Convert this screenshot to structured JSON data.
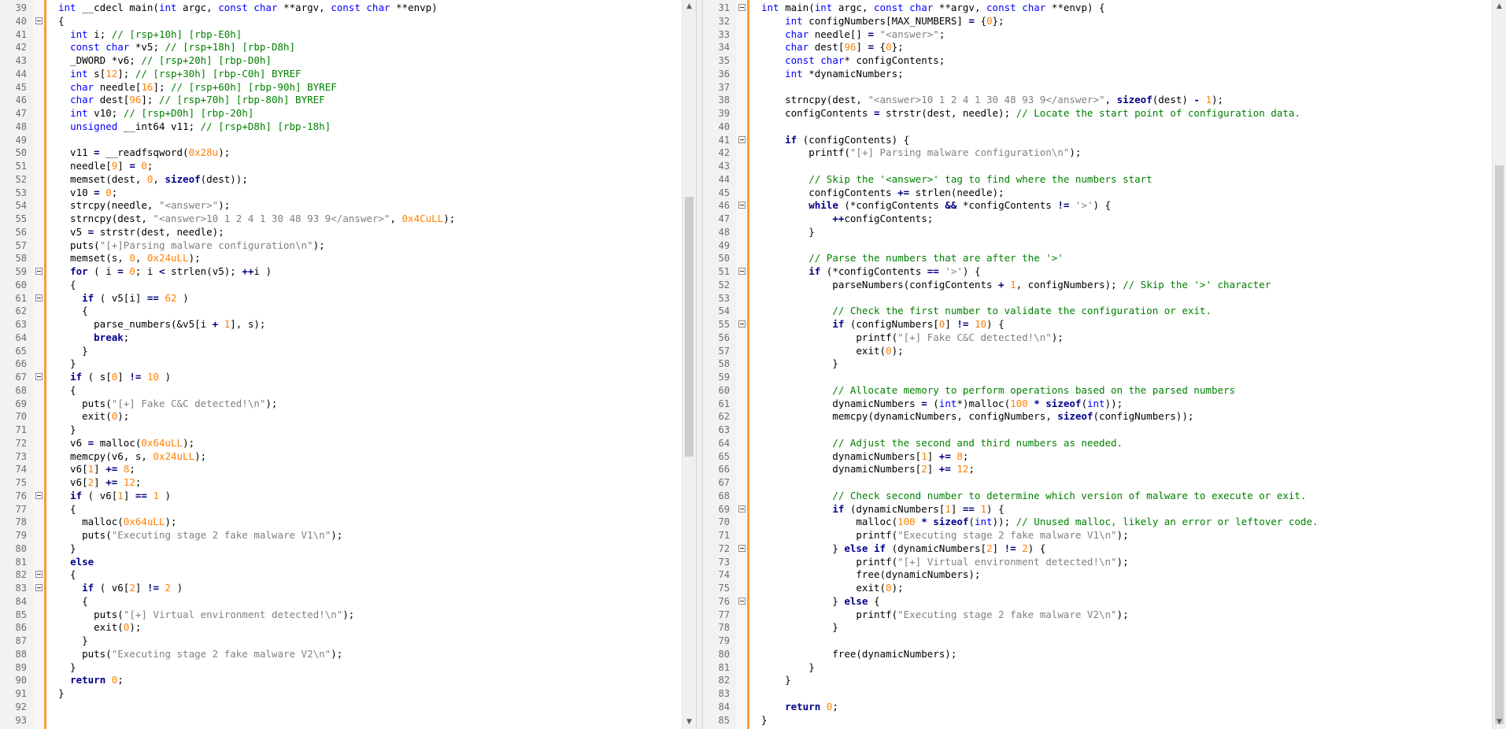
{
  "left_pane": {
    "lines": [
      {
        "n": "39",
        "fold": false,
        "html": "<span class=\"kw\">int</span> __cdecl main(<span class=\"kw\">int</span> argc, <span class=\"kw\">const</span> <span class=\"kw\">char</span> **argv, <span class=\"kw\">const</span> <span class=\"kw\">char</span> **envp)"
      },
      {
        "n": "40",
        "fold": true,
        "html": "{"
      },
      {
        "n": "41",
        "fold": false,
        "html": "  <span class=\"kw\">int</span> i; <span class=\"cm\">// [rsp+10h] [rbp-E0h]</span>"
      },
      {
        "n": "42",
        "fold": false,
        "html": "  <span class=\"kw\">const</span> <span class=\"kw\">char</span> *v5; <span class=\"cm\">// [rsp+18h] [rbp-D8h]</span>"
      },
      {
        "n": "43",
        "fold": false,
        "html": "  _DWORD *v6; <span class=\"cm\">// [rsp+20h] [rbp-D0h]</span>"
      },
      {
        "n": "44",
        "fold": false,
        "html": "  <span class=\"kw\">int</span> s[<span class=\"num\">12</span>]; <span class=\"cm\">// [rsp+30h] [rbp-C0h] BYREF</span>"
      },
      {
        "n": "45",
        "fold": false,
        "html": "  <span class=\"kw\">char</span> needle[<span class=\"num\">16</span>]; <span class=\"cm\">// [rsp+60h] [rbp-90h] BYREF</span>"
      },
      {
        "n": "46",
        "fold": false,
        "html": "  <span class=\"kw\">char</span> dest[<span class=\"num\">96</span>]; <span class=\"cm\">// [rsp+70h] [rbp-80h] BYREF</span>"
      },
      {
        "n": "47",
        "fold": false,
        "html": "  <span class=\"kw\">int</span> v10; <span class=\"cm\">// [rsp+D0h] [rbp-20h]</span>"
      },
      {
        "n": "48",
        "fold": false,
        "html": "  <span class=\"kw\">unsigned</span> __int64 v11; <span class=\"cm\">// [rsp+D8h] [rbp-18h]</span>"
      },
      {
        "n": "49",
        "fold": false,
        "html": ""
      },
      {
        "n": "50",
        "fold": false,
        "html": "  v11 <span class=\"op\">=</span> __readfsqword(<span class=\"num\">0x28u</span>);"
      },
      {
        "n": "51",
        "fold": false,
        "html": "  needle[<span class=\"num\">9</span>] <span class=\"op\">=</span> <span class=\"num\">0</span>;"
      },
      {
        "n": "52",
        "fold": false,
        "html": "  memset(dest, <span class=\"num\">0</span>, <span class=\"kwb\">sizeof</span>(dest));"
      },
      {
        "n": "53",
        "fold": false,
        "html": "  v10 <span class=\"op\">=</span> <span class=\"num\">0</span>;"
      },
      {
        "n": "54",
        "fold": false,
        "html": "  strcpy(needle, <span class=\"str\">\"&lt;answer&gt;\"</span>);"
      },
      {
        "n": "55",
        "fold": false,
        "html": "  strncpy(dest, <span class=\"str\">\"&lt;answer&gt;10 1 2 4 1 30 48 93 9&lt;/answer&gt;\"</span>, <span class=\"num\">0x4CuLL</span>);"
      },
      {
        "n": "56",
        "fold": false,
        "html": "  v5 <span class=\"op\">=</span> strstr(dest, needle);"
      },
      {
        "n": "57",
        "fold": false,
        "html": "  puts(<span class=\"str\">\"[+]Parsing malware configuration\\n\"</span>);"
      },
      {
        "n": "58",
        "fold": false,
        "html": "  memset(s, <span class=\"num\">0</span>, <span class=\"num\">0x24uLL</span>);"
      },
      {
        "n": "59",
        "fold": true,
        "html": "  <span class=\"kwb\">for</span> ( i <span class=\"op\">=</span> <span class=\"num\">0</span>; i <span class=\"op\">&lt;</span> strlen(v5); <span class=\"op\">++</span>i )"
      },
      {
        "n": "60",
        "fold": false,
        "html": "  {"
      },
      {
        "n": "61",
        "fold": true,
        "html": "    <span class=\"kwb\">if</span> ( v5[i] <span class=\"op\">==</span> <span class=\"num\">62</span> )"
      },
      {
        "n": "62",
        "fold": false,
        "html": "    {"
      },
      {
        "n": "63",
        "fold": false,
        "html": "      parse_numbers(&amp;v5[i <span class=\"op\">+</span> <span class=\"num\">1</span>], s);"
      },
      {
        "n": "64",
        "fold": false,
        "html": "      <span class=\"kwb\">break</span>;"
      },
      {
        "n": "65",
        "fold": false,
        "html": "    }"
      },
      {
        "n": "66",
        "fold": false,
        "html": "  }"
      },
      {
        "n": "67",
        "fold": true,
        "html": "  <span class=\"kwb\">if</span> ( s[<span class=\"num\">0</span>] <span class=\"op\">!=</span> <span class=\"num\">10</span> )"
      },
      {
        "n": "68",
        "fold": false,
        "html": "  {"
      },
      {
        "n": "69",
        "fold": false,
        "html": "    puts(<span class=\"str\">\"[+] Fake C&amp;C detected!\\n\"</span>);"
      },
      {
        "n": "70",
        "fold": false,
        "html": "    exit(<span class=\"num\">0</span>);"
      },
      {
        "n": "71",
        "fold": false,
        "html": "  }"
      },
      {
        "n": "72",
        "fold": false,
        "html": "  v6 <span class=\"op\">=</span> malloc(<span class=\"num\">0x64uLL</span>);"
      },
      {
        "n": "73",
        "fold": false,
        "html": "  memcpy(v6, s, <span class=\"num\">0x24uLL</span>);"
      },
      {
        "n": "74",
        "fold": false,
        "html": "  v6[<span class=\"num\">1</span>] <span class=\"op\">+=</span> <span class=\"num\">8</span>;"
      },
      {
        "n": "75",
        "fold": false,
        "html": "  v6[<span class=\"num\">2</span>] <span class=\"op\">+=</span> <span class=\"num\">12</span>;"
      },
      {
        "n": "76",
        "fold": true,
        "html": "  <span class=\"kwb\">if</span> ( v6[<span class=\"num\">1</span>] <span class=\"op\">==</span> <span class=\"num\">1</span> )"
      },
      {
        "n": "77",
        "fold": false,
        "html": "  {"
      },
      {
        "n": "78",
        "fold": false,
        "html": "    malloc(<span class=\"num\">0x64uLL</span>);"
      },
      {
        "n": "79",
        "fold": false,
        "html": "    puts(<span class=\"str\">\"Executing stage 2 fake malware V1\\n\"</span>);"
      },
      {
        "n": "80",
        "fold": false,
        "html": "  }"
      },
      {
        "n": "81",
        "fold": false,
        "html": "  <span class=\"kwb\">else</span>"
      },
      {
        "n": "82",
        "fold": true,
        "html": "  {"
      },
      {
        "n": "83",
        "fold": true,
        "html": "    <span class=\"kwb\">if</span> ( v6[<span class=\"num\">2</span>] <span class=\"op\">!=</span> <span class=\"num\">2</span> )"
      },
      {
        "n": "84",
        "fold": false,
        "html": "    {"
      },
      {
        "n": "85",
        "fold": false,
        "html": "      puts(<span class=\"str\">\"[+] Virtual environment detected!\\n\"</span>);"
      },
      {
        "n": "86",
        "fold": false,
        "html": "      exit(<span class=\"num\">0</span>);"
      },
      {
        "n": "87",
        "fold": false,
        "html": "    }"
      },
      {
        "n": "88",
        "fold": false,
        "html": "    puts(<span class=\"str\">\"Executing stage 2 fake malware V2\\n\"</span>);"
      },
      {
        "n": "89",
        "fold": false,
        "html": "  }"
      },
      {
        "n": "90",
        "fold": false,
        "html": "  <span class=\"kwb\">return</span> <span class=\"num\">0</span>;"
      },
      {
        "n": "91",
        "fold": false,
        "html": "}"
      },
      {
        "n": "92",
        "fold": false,
        "html": ""
      },
      {
        "n": "93",
        "fold": false,
        "html": ""
      }
    ]
  },
  "right_pane": {
    "lines": [
      {
        "n": "31",
        "fold": true,
        "html": "<span class=\"kw\">int</span> main(<span class=\"kw\">int</span> argc, <span class=\"kw\">const</span> <span class=\"kw\">char</span> **argv, <span class=\"kw\">const</span> <span class=\"kw\">char</span> **envp) {"
      },
      {
        "n": "32",
        "fold": false,
        "html": "    <span class=\"kw\">int</span> configNumbers[MAX_NUMBERS] <span class=\"op\">=</span> {<span class=\"num\">0</span>};"
      },
      {
        "n": "33",
        "fold": false,
        "html": "    <span class=\"kw\">char</span> needle[] <span class=\"op\">=</span> <span class=\"str\">\"&lt;answer&gt;\"</span>;"
      },
      {
        "n": "34",
        "fold": false,
        "html": "    <span class=\"kw\">char</span> dest[<span class=\"num\">96</span>] <span class=\"op\">=</span> {<span class=\"num\">0</span>};"
      },
      {
        "n": "35",
        "fold": false,
        "html": "    <span class=\"kw\">const</span> <span class=\"kw\">char</span>* configContents;"
      },
      {
        "n": "36",
        "fold": false,
        "html": "    <span class=\"kw\">int</span> *dynamicNumbers;"
      },
      {
        "n": "37",
        "fold": false,
        "html": "    "
      },
      {
        "n": "38",
        "fold": false,
        "html": "    strncpy(dest, <span class=\"str\">\"&lt;answer&gt;10 1 2 4 1 30 48 93 9&lt;/answer&gt;\"</span>, <span class=\"kwb\">sizeof</span>(dest) <span class=\"op\">-</span> <span class=\"num\">1</span>);"
      },
      {
        "n": "39",
        "fold": false,
        "html": "    configContents <span class=\"op\">=</span> strstr(dest, needle); <span class=\"cm\">// Locate the start point of configuration data.</span>"
      },
      {
        "n": "40",
        "fold": false,
        "html": "    "
      },
      {
        "n": "41",
        "fold": true,
        "html": "    <span class=\"kwb\">if</span> (configContents) {"
      },
      {
        "n": "42",
        "fold": false,
        "html": "        printf(<span class=\"str\">\"[+] Parsing malware configuration\\n\"</span>);"
      },
      {
        "n": "43",
        "fold": false,
        "html": "        "
      },
      {
        "n": "44",
        "fold": false,
        "html": "        <span class=\"cm\">// Skip the '&lt;answer&gt;' tag to find where the numbers start</span>"
      },
      {
        "n": "45",
        "fold": false,
        "html": "        configContents <span class=\"op\">+=</span> strlen(needle);"
      },
      {
        "n": "46",
        "fold": true,
        "html": "        <span class=\"kwb\">while</span> (*configContents <span class=\"op\">&amp;&amp;</span> *configContents <span class=\"op\">!=</span> <span class=\"str\">'&gt;'</span>) {"
      },
      {
        "n": "47",
        "fold": false,
        "html": "            <span class=\"op\">++</span>configContents;"
      },
      {
        "n": "48",
        "fold": false,
        "html": "        }"
      },
      {
        "n": "49",
        "fold": false,
        "html": "        "
      },
      {
        "n": "50",
        "fold": false,
        "html": "        <span class=\"cm\">// Parse the numbers that are after the '&gt;'</span>"
      },
      {
        "n": "51",
        "fold": true,
        "html": "        <span class=\"kwb\">if</span> (*configContents <span class=\"op\">==</span> <span class=\"str\">'&gt;'</span>) {"
      },
      {
        "n": "52",
        "fold": false,
        "html": "            parseNumbers(configContents <span class=\"op\">+</span> <span class=\"num\">1</span>, configNumbers); <span class=\"cm\">// Skip the '&gt;' character</span>"
      },
      {
        "n": "53",
        "fold": false,
        "html": "            "
      },
      {
        "n": "54",
        "fold": false,
        "html": "            <span class=\"cm\">// Check the first number to validate the configuration or exit.</span>"
      },
      {
        "n": "55",
        "fold": true,
        "html": "            <span class=\"kwb\">if</span> (configNumbers[<span class=\"num\">0</span>] <span class=\"op\">!=</span> <span class=\"num\">10</span>) {"
      },
      {
        "n": "56",
        "fold": false,
        "html": "                printf(<span class=\"str\">\"[+] Fake C&amp;C detected!\\n\"</span>);"
      },
      {
        "n": "57",
        "fold": false,
        "html": "                exit(<span class=\"num\">0</span>);"
      },
      {
        "n": "58",
        "fold": false,
        "html": "            }"
      },
      {
        "n": "59",
        "fold": false,
        "html": "            "
      },
      {
        "n": "60",
        "fold": false,
        "html": "            <span class=\"cm\">// Allocate memory to perform operations based on the parsed numbers</span>"
      },
      {
        "n": "61",
        "fold": false,
        "html": "            dynamicNumbers <span class=\"op\">=</span> (<span class=\"kw\">int</span>*)malloc(<span class=\"num\">100</span> <span class=\"op\">*</span> <span class=\"kwb\">sizeof</span>(<span class=\"kw\">int</span>));"
      },
      {
        "n": "62",
        "fold": false,
        "html": "            memcpy(dynamicNumbers, configNumbers, <span class=\"kwb\">sizeof</span>(configNumbers));"
      },
      {
        "n": "63",
        "fold": false,
        "html": "            "
      },
      {
        "n": "64",
        "fold": false,
        "html": "            <span class=\"cm\">// Adjust the second and third numbers as needed.</span>"
      },
      {
        "n": "65",
        "fold": false,
        "html": "            dynamicNumbers[<span class=\"num\">1</span>] <span class=\"op\">+=</span> <span class=\"num\">8</span>;"
      },
      {
        "n": "66",
        "fold": false,
        "html": "            dynamicNumbers[<span class=\"num\">2</span>] <span class=\"op\">+=</span> <span class=\"num\">12</span>;"
      },
      {
        "n": "67",
        "fold": false,
        "html": "            "
      },
      {
        "n": "68",
        "fold": false,
        "html": "            <span class=\"cm\">// Check second number to determine which version of malware to execute or exit.</span>"
      },
      {
        "n": "69",
        "fold": true,
        "html": "            <span class=\"kwb\">if</span> (dynamicNumbers[<span class=\"num\">1</span>] <span class=\"op\">==</span> <span class=\"num\">1</span>) {"
      },
      {
        "n": "70",
        "fold": false,
        "html": "                malloc(<span class=\"num\">100</span> <span class=\"op\">*</span> <span class=\"kwb\">sizeof</span>(<span class=\"kw\">int</span>)); <span class=\"cm\">// Unused malloc, likely an error or leftover code.</span>"
      },
      {
        "n": "71",
        "fold": false,
        "html": "                printf(<span class=\"str\">\"Executing stage 2 fake malware V1\\n\"</span>);"
      },
      {
        "n": "72",
        "fold": true,
        "html": "            } <span class=\"kwb\">else</span> <span class=\"kwb\">if</span> (dynamicNumbers[<span class=\"num\">2</span>] <span class=\"op\">!=</span> <span class=\"num\">2</span>) {"
      },
      {
        "n": "73",
        "fold": false,
        "html": "                printf(<span class=\"str\">\"[+] Virtual environment detected!\\n\"</span>);"
      },
      {
        "n": "74",
        "fold": false,
        "html": "                free(dynamicNumbers);"
      },
      {
        "n": "75",
        "fold": false,
        "html": "                exit(<span class=\"num\">0</span>);"
      },
      {
        "n": "76",
        "fold": true,
        "html": "            } <span class=\"kwb\">else</span> {"
      },
      {
        "n": "77",
        "fold": false,
        "html": "                printf(<span class=\"str\">\"Executing stage 2 fake malware V2\\n\"</span>);"
      },
      {
        "n": "78",
        "fold": false,
        "html": "            }"
      },
      {
        "n": "79",
        "fold": false,
        "html": ""
      },
      {
        "n": "80",
        "fold": false,
        "html": "            free(dynamicNumbers);"
      },
      {
        "n": "81",
        "fold": false,
        "html": "        }"
      },
      {
        "n": "82",
        "fold": false,
        "html": "    }"
      },
      {
        "n": "83",
        "fold": false,
        "html": ""
      },
      {
        "n": "84",
        "fold": false,
        "html": "    <span class=\"kwb\">return</span> <span class=\"num\">0</span>;"
      },
      {
        "n": "85",
        "fold": false,
        "html": "}"
      }
    ]
  },
  "scroll": {
    "up_glyph": "▲",
    "down_glyph": "▼"
  }
}
